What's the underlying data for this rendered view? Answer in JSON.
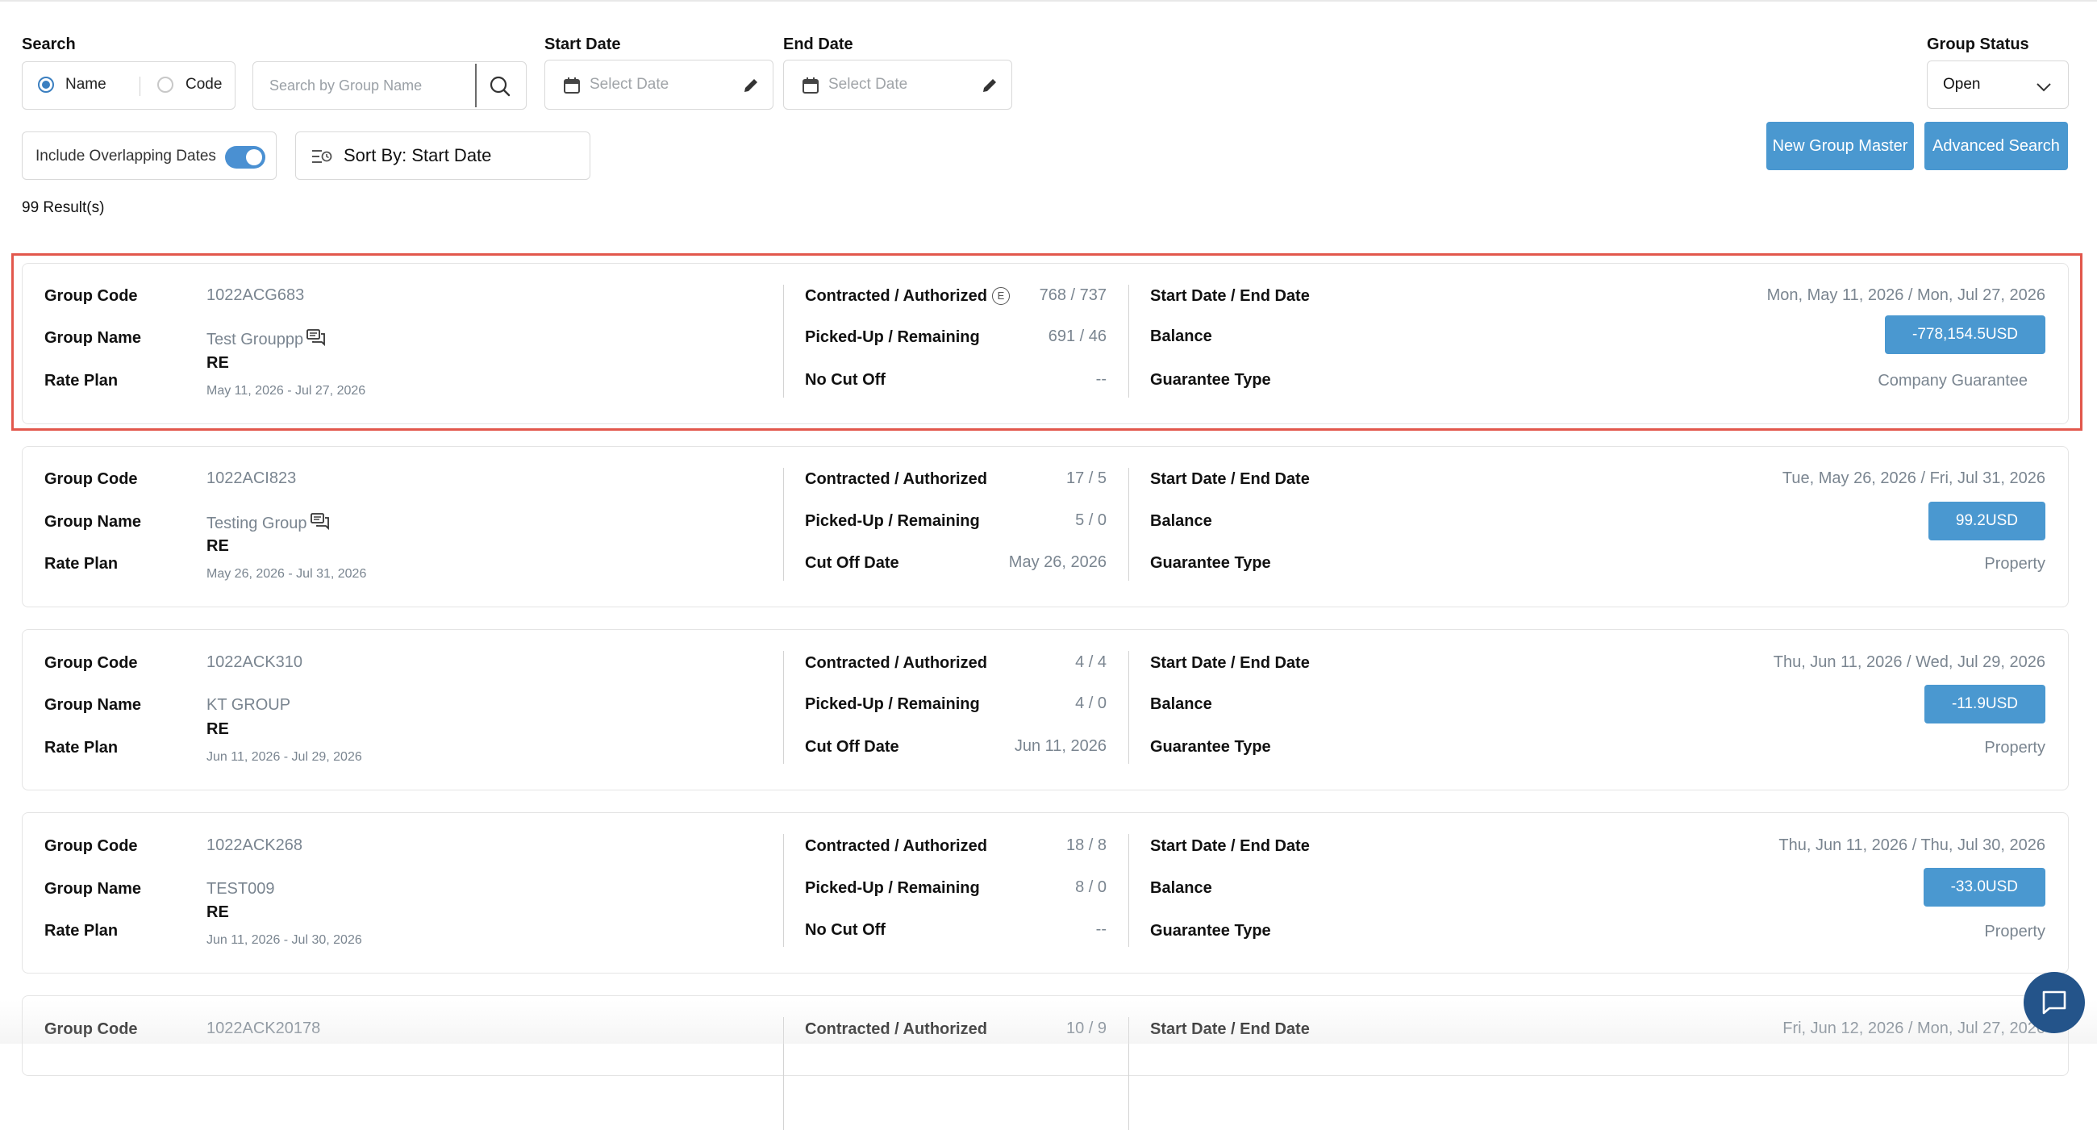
{
  "filters": {
    "search_label": "Search",
    "radio_name": "Name",
    "radio_code": "Code",
    "search_placeholder": "Search by Group Name",
    "start_date_label": "Start Date",
    "start_date_placeholder": "Select Date",
    "end_date_label": "End Date",
    "end_date_placeholder": "Select Date",
    "group_status_label": "Group Status",
    "group_status_value": "Open",
    "overlap_label": "Include Overlapping Dates",
    "overlap_on": true,
    "sort_label": "Sort By: Start Date"
  },
  "actions": {
    "new_group_master": "New Group Master",
    "advanced_search": "Advanced Search"
  },
  "results_count": "99 Result(s)",
  "labels": {
    "group_code": "Group Code",
    "group_name": "Group Name",
    "rate_plan": "Rate Plan",
    "contracted": "Contracted / Authorized",
    "picked_up": "Picked-Up / Remaining",
    "start_end": "Start Date / End Date",
    "balance": "Balance",
    "guarantee": "Guarantee Type",
    "e_badge": "E"
  },
  "colors": {
    "accent": "#4a98d0",
    "highlight": "#e2574c",
    "chat_fab": "#24548a"
  },
  "groups": [
    {
      "code": "1022ACG683",
      "name": "Test Grouppp",
      "rate_plan": "RE",
      "rate_dates": "May 11, 2026 - Jul 27, 2026",
      "contracted": "768 / 737",
      "picked_up": "691 / 46",
      "cutoff_label": "No Cut Off",
      "cutoff_value": "--",
      "dates": "Mon, May 11, 2026 / Mon, Jul 27, 2026",
      "balance": "-778,154.5USD",
      "guarantee": "Company Guarantee"
    },
    {
      "code": "1022ACI823",
      "name": "Testing Group",
      "rate_plan": "RE",
      "rate_dates": "May 26, 2026 - Jul 31, 2026",
      "contracted": "17 / 5",
      "picked_up": "5 / 0",
      "cutoff_label": "Cut Off Date",
      "cutoff_value": "May 26, 2026",
      "dates": "Tue, May 26, 2026 / Fri, Jul 31, 2026",
      "balance": "99.2USD",
      "guarantee": "Property"
    },
    {
      "code": "1022ACK310",
      "name": "KT GROUP",
      "rate_plan": "RE",
      "rate_dates": "Jun 11, 2026 - Jul 29, 2026",
      "contracted": "4 / 4",
      "picked_up": "4 / 0",
      "cutoff_label": "Cut Off Date",
      "cutoff_value": "Jun 11, 2026",
      "dates": "Thu, Jun 11, 2026 / Wed, Jul 29, 2026",
      "balance": "-11.9USD",
      "guarantee": "Property"
    },
    {
      "code": "1022ACK268",
      "name": "TEST009",
      "rate_plan": "RE",
      "rate_dates": "Jun 11, 2026 - Jul 30, 2026",
      "contracted": "18 / 8",
      "picked_up": "8 / 0",
      "cutoff_label": "No Cut Off",
      "cutoff_value": "--",
      "dates": "Thu, Jun 11, 2026 / Thu, Jul 30, 2026",
      "balance": "-33.0USD",
      "guarantee": "Property"
    },
    {
      "code": "1022ACK20178",
      "contracted": "10 / 9",
      "dates": "Fri, Jun 12, 2026 / Mon, Jul 27, 2026"
    }
  ]
}
